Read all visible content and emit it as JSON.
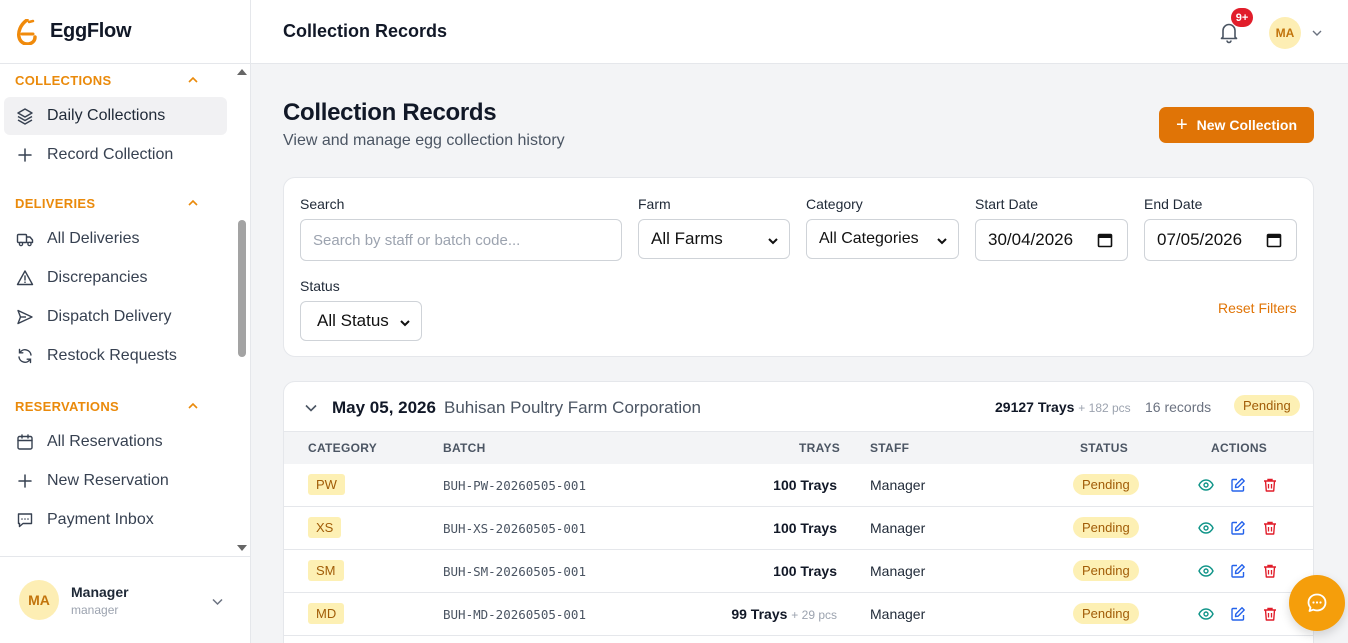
{
  "brand": {
    "name": "EggFlow"
  },
  "sidebar": {
    "sections": [
      {
        "title": "COLLECTIONS",
        "items": [
          {
            "label": "Daily Collections",
            "icon": "layers-icon",
            "active": true
          },
          {
            "label": "Record Collection",
            "icon": "plus-icon"
          }
        ]
      },
      {
        "title": "DELIVERIES",
        "items": [
          {
            "label": "All Deliveries",
            "icon": "truck-icon"
          },
          {
            "label": "Discrepancies",
            "icon": "warning-icon"
          },
          {
            "label": "Dispatch Delivery",
            "icon": "send-icon"
          },
          {
            "label": "Restock Requests",
            "icon": "refresh-icon"
          }
        ]
      },
      {
        "title": "RESERVATIONS",
        "items": [
          {
            "label": "All Reservations",
            "icon": "calendar-icon"
          },
          {
            "label": "New Reservation",
            "icon": "plus-icon"
          },
          {
            "label": "Payment Inbox",
            "icon": "message-icon"
          }
        ]
      }
    ],
    "user": {
      "initials": "MA",
      "name": "Manager",
      "role": "manager"
    }
  },
  "topbar": {
    "title": "Collection Records",
    "badge": "9+",
    "initials": "MA"
  },
  "page": {
    "title": "Collection Records",
    "subtitle": "View and manage egg collection history",
    "new_button": "New Collection"
  },
  "filters": {
    "search_label": "Search",
    "search_placeholder": "Search by staff or batch code...",
    "farm_label": "Farm",
    "farm_value": "All Farms",
    "category_label": "Category",
    "category_value": "All Categories",
    "start_label": "Start Date",
    "start_value": "30/04/2026",
    "end_label": "End Date",
    "end_value": "07/05/2026",
    "status_label": "Status",
    "status_value": "All Status",
    "reset": "Reset Filters"
  },
  "group": {
    "date": "May 05, 2026",
    "farm": "Buhisan Poultry Farm Corporation",
    "trays": "29127 Trays",
    "pcs": "+ 182 pcs",
    "records": "16 records",
    "status": "Pending"
  },
  "table": {
    "headers": {
      "category": "CATEGORY",
      "batch": "BATCH",
      "trays": "TRAYS",
      "staff": "STAFF",
      "status": "STATUS",
      "actions": "ACTIONS"
    },
    "rows": [
      {
        "category": "PW",
        "batch": "BUH-PW-20260505-001",
        "trays": "100 Trays",
        "pcs": "",
        "staff": "Manager",
        "status": "Pending"
      },
      {
        "category": "XS",
        "batch": "BUH-XS-20260505-001",
        "trays": "100 Trays",
        "pcs": "",
        "staff": "Manager",
        "status": "Pending"
      },
      {
        "category": "SM",
        "batch": "BUH-SM-20260505-001",
        "trays": "100 Trays",
        "pcs": "",
        "staff": "Manager",
        "status": "Pending"
      },
      {
        "category": "MD",
        "batch": "BUH-MD-20260505-001",
        "trays": "99 Trays",
        "pcs": "+ 29 pcs",
        "staff": "Manager",
        "status": "Pending"
      }
    ]
  },
  "colors": {
    "accent": "#e07406",
    "section": "#ea8a0b",
    "pill_bg": "#fdf0b4",
    "danger": "#e11d2a",
    "view": "#0f9488",
    "edit": "#2563eb"
  }
}
